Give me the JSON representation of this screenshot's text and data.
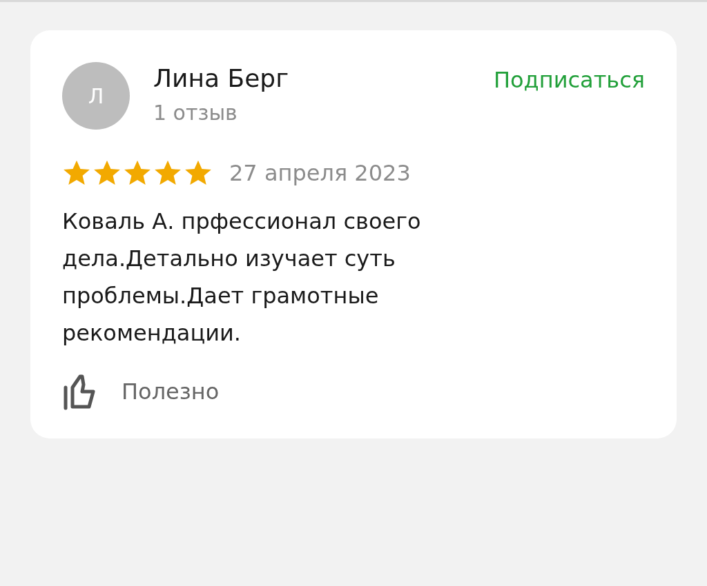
{
  "review": {
    "avatar_letter": "Л",
    "author": "Лина Берг",
    "reviews_count": "1 отзыв",
    "subscribe": "Подписаться",
    "stars": 5,
    "date": "27 апреля 2023",
    "text": "Коваль А. прфессионал своего дела.Детально изучает суть проблемы.Дает грамотные рекомендации.",
    "helpful": "Полезно"
  }
}
